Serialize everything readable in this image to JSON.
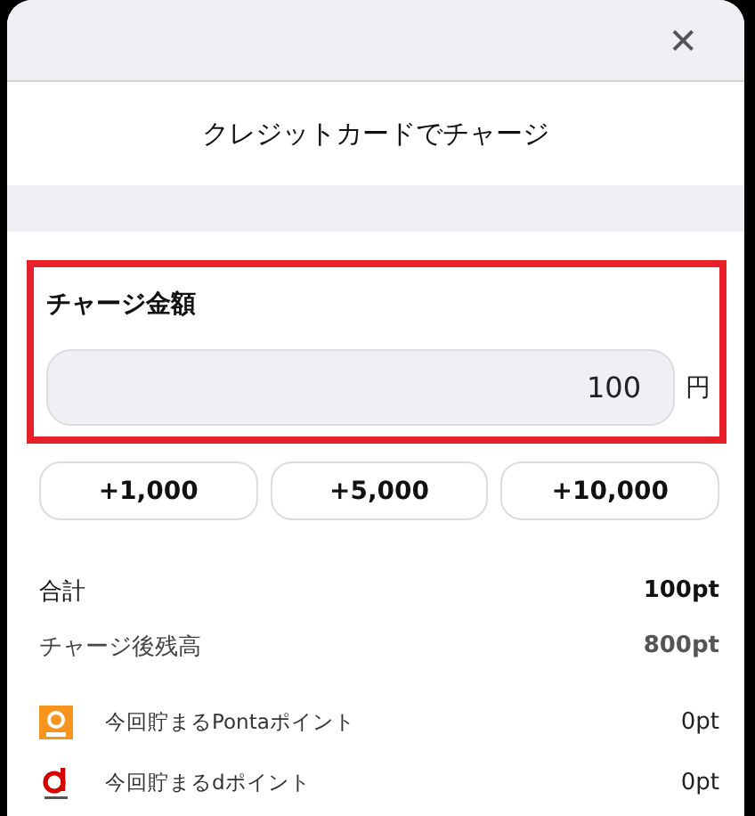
{
  "header": {
    "close": "✕",
    "title": "クレジットカードでチャージ"
  },
  "amount": {
    "label": "チャージ金額",
    "value": "100",
    "unit": "円",
    "highlighted": true
  },
  "quick_buttons": [
    "+1,000",
    "+5,000",
    "+10,000"
  ],
  "summary": [
    {
      "label": "合計",
      "value": "100pt",
      "kind": "total"
    },
    {
      "label": "チャージ後残高",
      "value": "800pt",
      "kind": "balance"
    }
  ],
  "points": [
    {
      "kind": "ponta",
      "label": "今回貯まるPontaポイント",
      "value": "0pt"
    },
    {
      "kind": "dpoint",
      "label": "今回貯まるdポイント",
      "value": "0pt"
    }
  ]
}
